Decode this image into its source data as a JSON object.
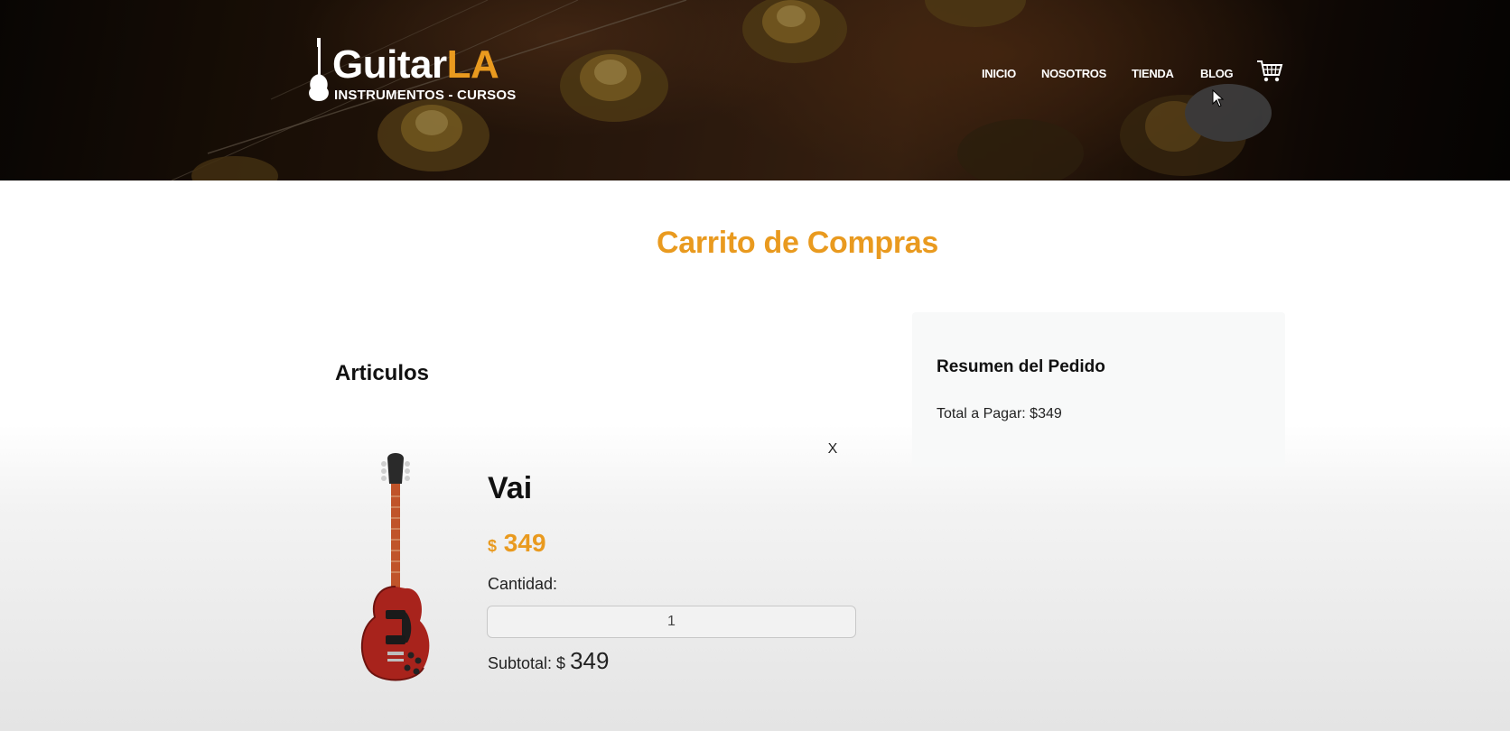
{
  "header": {
    "logo": {
      "brand_main": "Guitar",
      "brand_accent": "LA",
      "tagline": "INSTRUMENTOS - CURSOS"
    },
    "nav": [
      "INICIO",
      "NOSOTROS",
      "TIENDA",
      "BLOG"
    ],
    "cart_icon": "shopping-cart-icon"
  },
  "page_title": "Carrito de Compras",
  "articles": {
    "heading": "Articulos",
    "items": [
      {
        "name": "Vai",
        "currency": "$",
        "price": "349",
        "quantity_label": "Cantidad:",
        "quantity": "1",
        "subtotal_label": "Subtotal: $",
        "subtotal_value": "349",
        "remove_label": "X",
        "image_icon": "electric-guitar-image"
      }
    ]
  },
  "summary": {
    "heading": "Resumen del Pedido",
    "total": "Total a Pagar: $349"
  },
  "colors": {
    "accent": "#e99a1f",
    "header_dark": "#1a0f07"
  }
}
